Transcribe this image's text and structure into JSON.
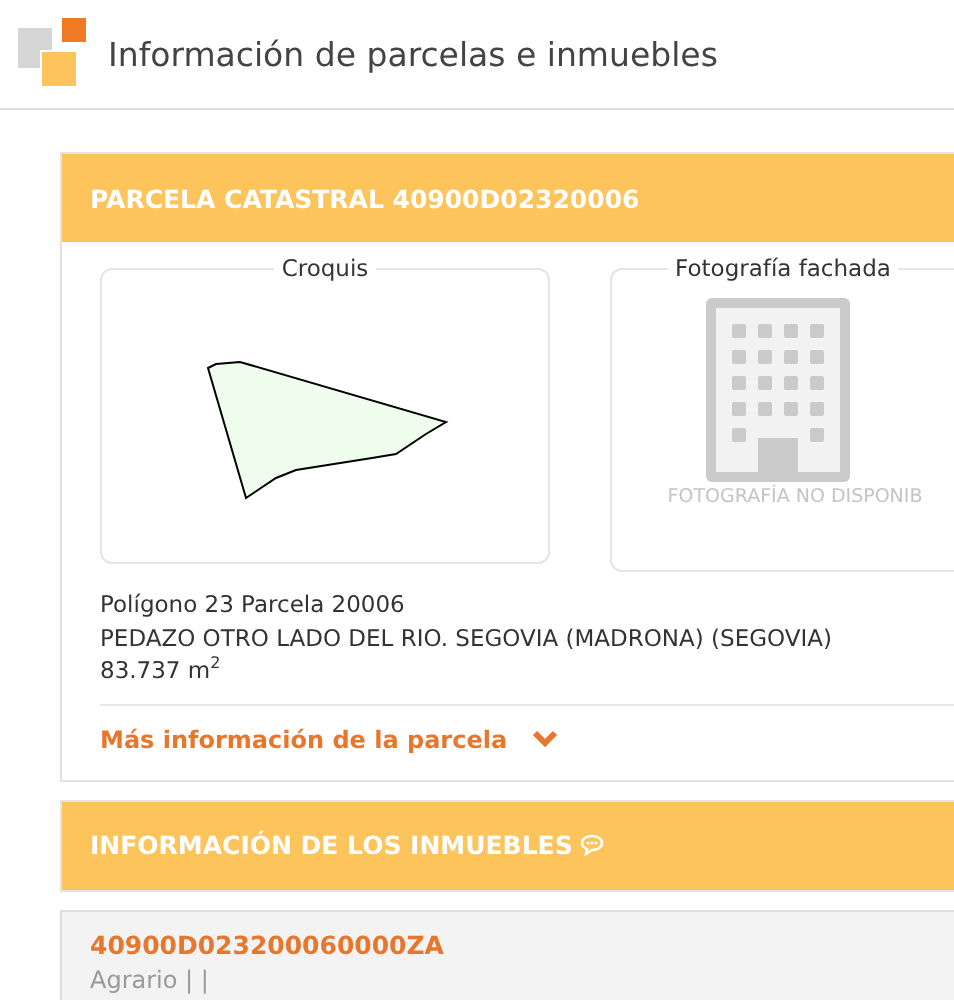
{
  "app": {
    "title": "Información de parcelas e inmuebles"
  },
  "parcel": {
    "header": "PARCELA CATASTRAL 40900D02320006",
    "sketch": {
      "legend": "Croquis"
    },
    "photo": {
      "legend": "Fotografía fachada",
      "message": "FOTOGRAFÍA NO DISPONIB"
    },
    "details": [
      "Polígono 23 Parcela 20006",
      "PEDAZO OTRO LADO DEL RIO. SEGOVIA (MADRONA) (SEGOVIA)",
      "83.737 m$^{2}$"
    ],
    "more_link": {
      "label": "Más información de la parcela",
      "expanded": false
    }
  },
  "properties": {
    "header": "INFORMACIÓN DE LOS INMUEBLES",
    "items": [
      {
        "reference": "40900D023200060000ZA",
        "use": "Agrario | |"
      }
    ]
  }
}
